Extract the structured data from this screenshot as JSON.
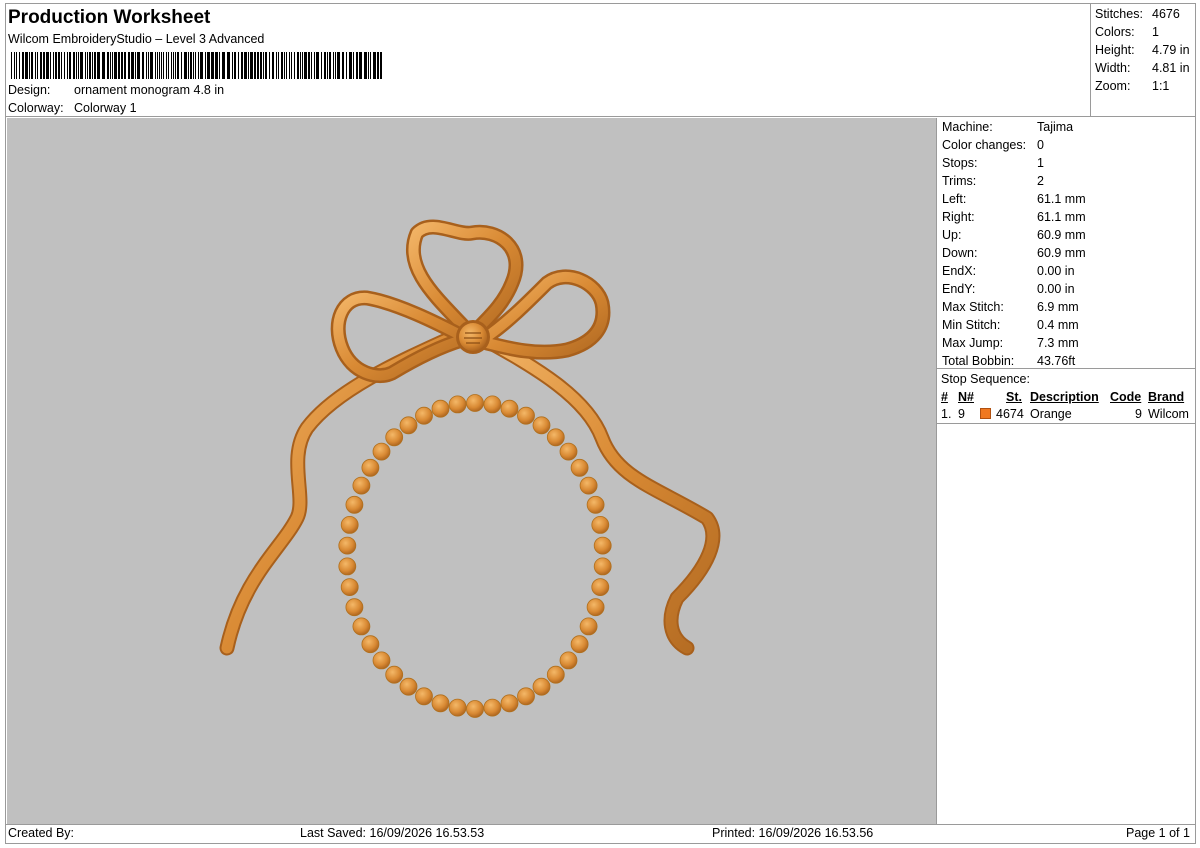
{
  "header": {
    "title": "Production Worksheet",
    "software": "Wilcom EmbroideryStudio – Level 3 Advanced",
    "design_label": "Design:",
    "design_value": "ornament monogram 4.8 in",
    "colorway_label": "Colorway:",
    "colorway_value": "Colorway 1"
  },
  "summary": {
    "stitches_label": "Stitches:",
    "stitches_value": "4676",
    "colors_label": "Colors:",
    "colors_value": "1",
    "height_label": "Height:",
    "height_value": "4.79 in",
    "width_label": "Width:",
    "width_value": "4.81 in",
    "zoom_label": "Zoom:",
    "zoom_value": "1:1"
  },
  "machine_info": [
    {
      "label": "Machine:",
      "value": "Tajima"
    },
    {
      "label": "Color changes:",
      "value": "0"
    },
    {
      "label": "Stops:",
      "value": "1"
    },
    {
      "label": "Trims:",
      "value": "2"
    },
    {
      "label": "Left:",
      "value": "61.1 mm"
    },
    {
      "label": "Right:",
      "value": "61.1 mm"
    },
    {
      "label": "Up:",
      "value": "60.9 mm"
    },
    {
      "label": "Down:",
      "value": "60.9 mm"
    },
    {
      "label": "EndX:",
      "value": "0.00 in"
    },
    {
      "label": "EndY:",
      "value": "0.00 in"
    },
    {
      "label": "Max Stitch:",
      "value": "6.9 mm"
    },
    {
      "label": "Min Stitch:",
      "value": "0.4 mm"
    },
    {
      "label": "Max Jump:",
      "value": "7.3 mm"
    },
    {
      "label": "Total Bobbin:",
      "value": "43.76ft"
    }
  ],
  "stop_sequence": {
    "title": "Stop Sequence:",
    "headers": {
      "num": "#",
      "n": "N#",
      "st": "St.",
      "description": "Description",
      "code": "Code",
      "brand": "Brand"
    },
    "rows": [
      {
        "num": "1.",
        "n": "9",
        "st": "4674",
        "description": "Orange",
        "code": "9",
        "brand": "Wilcom",
        "color": "#f07820"
      }
    ]
  },
  "footer": {
    "created_by": "Created By:",
    "last_saved": "Last Saved: 16/09/2026 16.53.53",
    "printed": "Printed: 16/09/2026 16.53.56",
    "page": "Page 1 of 1"
  },
  "design_colors": {
    "thread": "#d98a34",
    "thread_dark": "#a8601c",
    "thread_light": "#f0b060",
    "canvas": "#c0c0c0"
  }
}
